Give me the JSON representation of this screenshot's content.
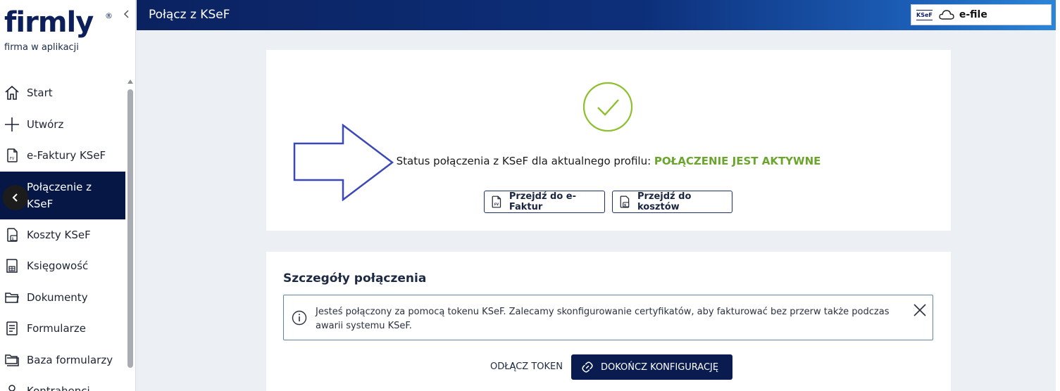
{
  "logo": {
    "word": "firmly",
    "reg": "®",
    "tagline": "firma w aplikacji"
  },
  "header": {
    "title": "Połącz z KSeF",
    "efile_badge": "KSeF",
    "efile_label": "e-file"
  },
  "sidebar": {
    "items": [
      {
        "label": "Start",
        "icon": "home-icon"
      },
      {
        "label": "Utwórz",
        "icon": "plus-icon"
      },
      {
        "label": "e-Faktury KSeF",
        "icon": "invoice-icon"
      },
      {
        "label": "Połączenie z KSeF",
        "icon": "back-arrow-icon",
        "active": true
      },
      {
        "label": "Koszty KSeF",
        "icon": "costs-icon"
      },
      {
        "label": "Księgowość",
        "icon": "ledger-icon"
      },
      {
        "label": "Dokumenty",
        "icon": "folder-icon"
      },
      {
        "label": "Formularze",
        "icon": "form-icon"
      },
      {
        "label": "Baza formularzy",
        "icon": "folders-icon"
      },
      {
        "label": "Kontrahenci",
        "icon": "person-icon"
      }
    ]
  },
  "status": {
    "prefix": "Status połączenia z KSeF dla aktualnego profilu: ",
    "value": "POŁĄCZENIE JEST AKTYWNE",
    "btn_efaktur": "Przejdź do e-Faktur",
    "btn_koszty": "Przejdź do kosztów"
  },
  "details": {
    "title": "Szczegóły połączenia",
    "info": "Jesteś połączony za pomocą tokenu KSeF. Zalecamy skonfigurowanie certyfikatów, aby fakturować bez przerw także podczas awarii systemu KSeF.",
    "btn_disconnect": "ODŁĄCZ TOKEN",
    "btn_finish": "DOKOŃCZ KONFIGURACJĘ"
  },
  "colors": {
    "navy": "#061746",
    "success": "#6aa52e",
    "check": "#8dbf2e",
    "arrow": "#3b48b8"
  }
}
